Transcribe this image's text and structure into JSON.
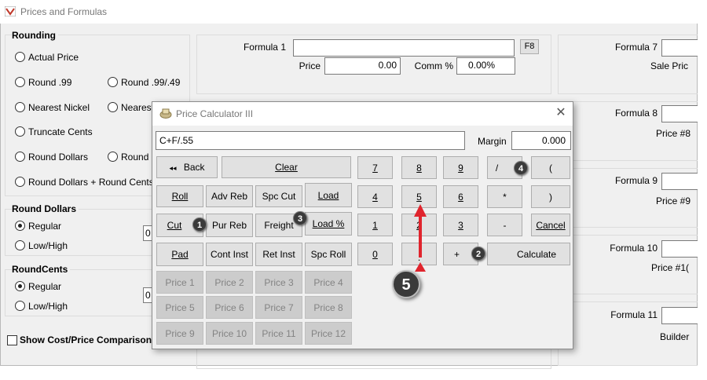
{
  "main": {
    "title": "Prices and Formulas",
    "rounding": {
      "title": "Rounding",
      "options": [
        "Actual Price",
        "Round .99",
        "Round .99/.49",
        "Nearest Nickel",
        "Nearest",
        "Truncate Cents",
        "Round Dollars",
        "Round C",
        "Round Dollars + Round Cents"
      ]
    },
    "round_dollars": {
      "title": "Round Dollars",
      "options": [
        "Regular",
        "Low/High"
      ],
      "selected": "Regular",
      "value_clip": "0"
    },
    "round_cents": {
      "title": "RoundCents",
      "options": [
        "Regular",
        "Low/High"
      ],
      "selected": "Regular",
      "value_clip": "0"
    },
    "show_cost_price": "Show Cost/Price Comparison",
    "formula1": {
      "label": "Formula 1",
      "value": "",
      "f8": "F8",
      "price_label": "Price",
      "price_value": "0.00",
      "comm_label": "Comm %",
      "comm_value": "0.00%"
    },
    "right_col": {
      "formula7": "Formula 7",
      "sale_price": "Sale Pric",
      "formula8": "Formula 8",
      "price8": "Price #8",
      "formula9": "Formula 9",
      "price9": "Price #9",
      "formula10": "Formula 10",
      "price10": "Price #1(",
      "formula11": "Formula 11",
      "builder": "Builder"
    }
  },
  "dialog": {
    "title": "Price Calculator III",
    "close": "✕",
    "formula_value": "C+F/.55",
    "margin_label": "Margin",
    "margin_value": "0.000",
    "buttons": {
      "back": "Back",
      "back_icon": "◂◂",
      "clear": "Clear",
      "roll": "Roll",
      "adv_reb": "Adv Reb",
      "spc_cut": "Spc Cut",
      "load": "Load",
      "cut": "Cut",
      "pur_reb": "Pur Reb",
      "freight": "Freight",
      "load_pct": "Load %",
      "pad": "Pad",
      "cont_inst": "Cont Inst",
      "ret_inst": "Ret Inst",
      "spc_roll": "Spc Roll",
      "prices": [
        "Price 1",
        "Price 2",
        "Price 3",
        "Price 4",
        "Price 5",
        "Price 6",
        "Price 7",
        "Price 8",
        "Price 9",
        "Price 10",
        "Price 11",
        "Price 12"
      ],
      "n7": "7",
      "n8": "8",
      "n9": "9",
      "div": "/",
      "lparen": "(",
      "n4": "4",
      "n5": "5",
      "n6": "6",
      "mul": "*",
      "rparen": ")",
      "n1": "1",
      "n2": "2",
      "n3": "3",
      "minus": "-",
      "cancel": "Cancel",
      "n0": "0",
      "dot": ".",
      "plus": "+",
      "calculate": "Calculate"
    }
  },
  "callouts": [
    "1",
    "2",
    "3",
    "4",
    "5"
  ],
  "colors": {
    "arrow": "#e0242d",
    "badge": "#3a3a3a",
    "disabled": "#838383"
  }
}
